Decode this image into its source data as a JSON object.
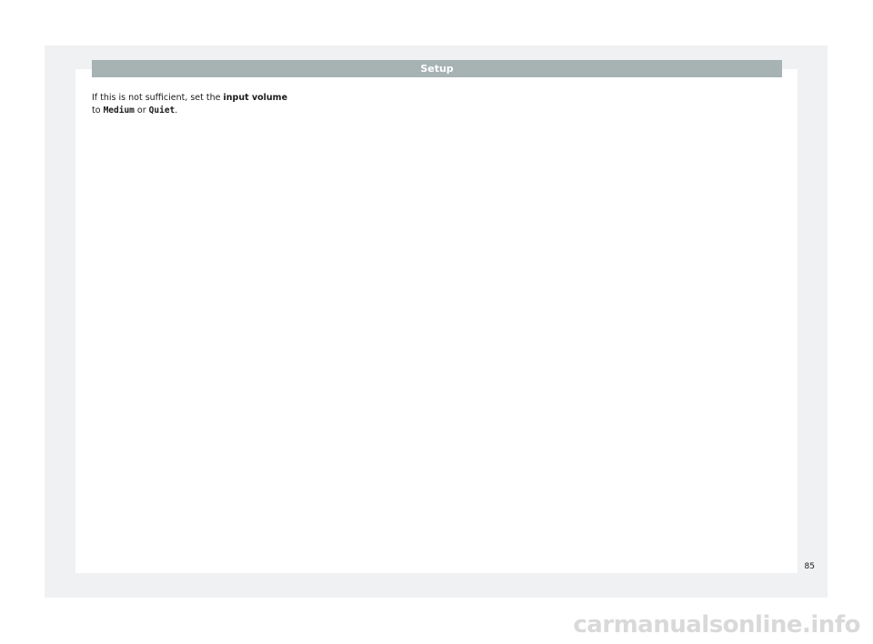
{
  "header": {
    "title": "Setup"
  },
  "content": {
    "line1_prefix": "If this is not sufficient, set the ",
    "line1_bold": "input volume",
    "line2_prefix": "to ",
    "option1": "Medium",
    "line2_middle": " or ",
    "option2": "Quiet",
    "line2_suffix": "."
  },
  "footer": {
    "page_number": "85"
  },
  "watermark": {
    "text": "carmanualsonline.info"
  }
}
